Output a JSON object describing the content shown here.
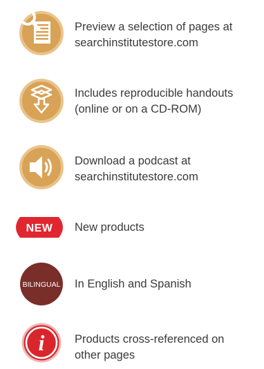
{
  "legend": {
    "items": [
      {
        "icon": "page-preview-icon",
        "lines": [
          "Preview a selection of pages at",
          "searchinstitutestore.com"
        ]
      },
      {
        "icon": "handout-download-icon",
        "lines": [
          "Includes reproducible handouts",
          "(online or on a CD-ROM)"
        ]
      },
      {
        "icon": "podcast-speaker-icon",
        "lines": [
          "Download a podcast at",
          "searchinstitutestore.com"
        ]
      },
      {
        "icon": "new-badge-icon",
        "badge_text": "NEW",
        "lines": [
          "New products"
        ]
      },
      {
        "icon": "bilingual-badge-icon",
        "badge_text": "BILINGUAL",
        "lines": [
          "In English and Spanish"
        ]
      },
      {
        "icon": "info-icon",
        "badge_text": "i",
        "lines": [
          "Products cross-referenced on",
          "other pages"
        ]
      }
    ]
  },
  "colors": {
    "gold": "#d8a257",
    "gold_light": "#e9c48b",
    "new_red": "#e0262f",
    "bilingual_maroon": "#7a2e2a",
    "info_red": "#d9262c",
    "text": "#3a3a3a"
  }
}
